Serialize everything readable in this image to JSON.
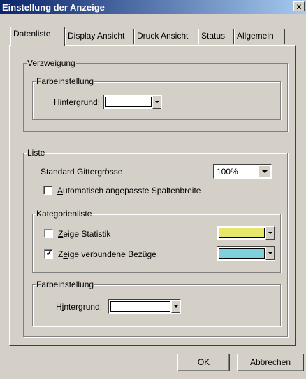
{
  "window": {
    "title": "Einstellung der Anzeige",
    "close_symbol": "x"
  },
  "tabs": [
    {
      "label": "Datenliste",
      "active": true
    },
    {
      "label": "Display Ansicht",
      "active": false
    },
    {
      "label": "Druck Ansicht",
      "active": false
    },
    {
      "label": "Status",
      "active": false
    },
    {
      "label": "Allgemein",
      "active": false
    }
  ],
  "verzweigung": {
    "title": "Verzweigung",
    "farbeinstellung": {
      "title": "Farbeinstellung",
      "hintergrund_label_prefix": "",
      "hintergrund_label_accel": "H",
      "hintergrund_label_rest": "intergrund:",
      "color": "#ffffff"
    }
  },
  "liste": {
    "title": "Liste",
    "gitter_label": "Standard Gittergrösse",
    "gitter_value": "100%",
    "auto_checkbox": {
      "accel": "A",
      "rest": "utomatisch angepasste Spaltenbreite",
      "checked": false
    },
    "kategorienliste": {
      "title": "Kategorienliste",
      "statistik": {
        "accel": "Z",
        "rest": "eige Statistik",
        "checked": false,
        "color": "#e6e66a"
      },
      "bezuege": {
        "prefix": "Z",
        "accel": "e",
        "rest": "ige verbundene Bezüge",
        "checked": true,
        "color": "#7fd0dd"
      }
    },
    "farbeinstellung": {
      "title": "Farbeinstellung",
      "hintergrund_prefix": "H",
      "hintergrund_accel": "i",
      "hintergrund_rest": "ntergrund:",
      "color": "#ffffff"
    }
  },
  "buttons": {
    "ok": "OK",
    "cancel": "Abbrechen"
  }
}
